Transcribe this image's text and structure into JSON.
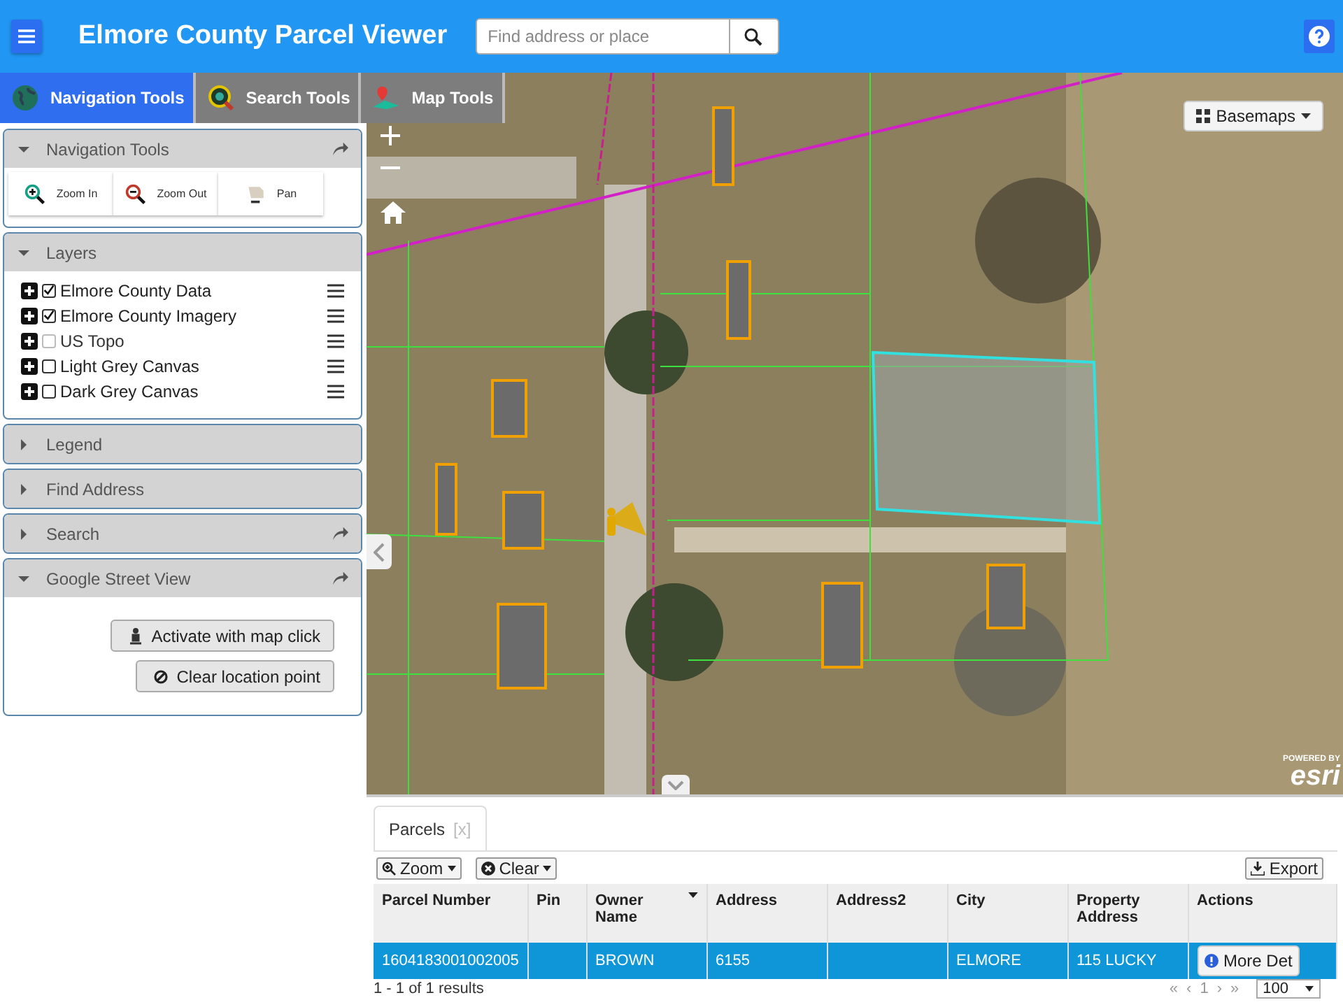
{
  "header": {
    "title": "Elmore County Parcel Viewer",
    "search": {
      "placeholder": "Find address or place"
    }
  },
  "tool_tabs": [
    {
      "label": "Navigation Tools",
      "selected": true,
      "kind": "globe"
    },
    {
      "label": "Search Tools",
      "selected": false,
      "kind": "search"
    },
    {
      "label": "Map Tools",
      "selected": false,
      "kind": "pin"
    }
  ],
  "panels": [
    {
      "title": "Navigation Tools",
      "expanded": true,
      "popout": true,
      "kind": "tools",
      "tools": [
        {
          "label": "Zoom In",
          "kind": "zoom-in"
        },
        {
          "label": "Zoom Out",
          "kind": "zoom-out"
        },
        {
          "label": "Pan",
          "kind": "pan"
        }
      ]
    },
    {
      "title": "Layers",
      "expanded": true,
      "popout": false,
      "kind": "layers",
      "layers": [
        {
          "name": "Elmore County Data",
          "checked": true,
          "disabled": false
        },
        {
          "name": "Elmore County Imagery",
          "checked": true,
          "disabled": false
        },
        {
          "name": "US Topo",
          "checked": false,
          "disabled": true
        },
        {
          "name": "Light Grey Canvas",
          "checked": false,
          "disabled": false
        },
        {
          "name": "Dark Grey Canvas",
          "checked": false,
          "disabled": false
        }
      ]
    },
    {
      "title": "Legend",
      "expanded": false,
      "popout": false
    },
    {
      "title": "Find Address",
      "expanded": false,
      "popout": false
    },
    {
      "title": "Search",
      "expanded": false,
      "popout": true
    },
    {
      "title": "Google Street View",
      "expanded": true,
      "popout": true,
      "kind": "buttons",
      "buttons": [
        {
          "label": "Activate with map click",
          "kind": "person"
        },
        {
          "label": "Clear location point",
          "kind": "clear"
        }
      ]
    }
  ],
  "map": {
    "basemaps_button": "Basemaps",
    "attribution": {
      "powered_by": "POWERED BY",
      "logo": "esri"
    }
  },
  "results": {
    "tab": {
      "label": "Parcels",
      "close": "[x]",
      "selected": true
    },
    "toolbar": {
      "zoom": "Zoom",
      "clear": "Clear",
      "export": "Export"
    },
    "table": {
      "columns": [
        "Parcel Number",
        "Pin",
        "Owner Name",
        "Address",
        "Address2",
        "City",
        "Property Address",
        "Actions"
      ],
      "rows": [
        {
          "selected": true,
          "cells": [
            "1604183001002005",
            "",
            "BROWN",
            "6155",
            "",
            "ELMORE",
            "115 LUCKY"
          ],
          "action": "More Det"
        }
      ]
    },
    "footer": {
      "summary": "1 - 1 of 1 results",
      "pager": [
        "«",
        "‹",
        "1",
        "›",
        "»"
      ],
      "page_size": "100"
    }
  }
}
